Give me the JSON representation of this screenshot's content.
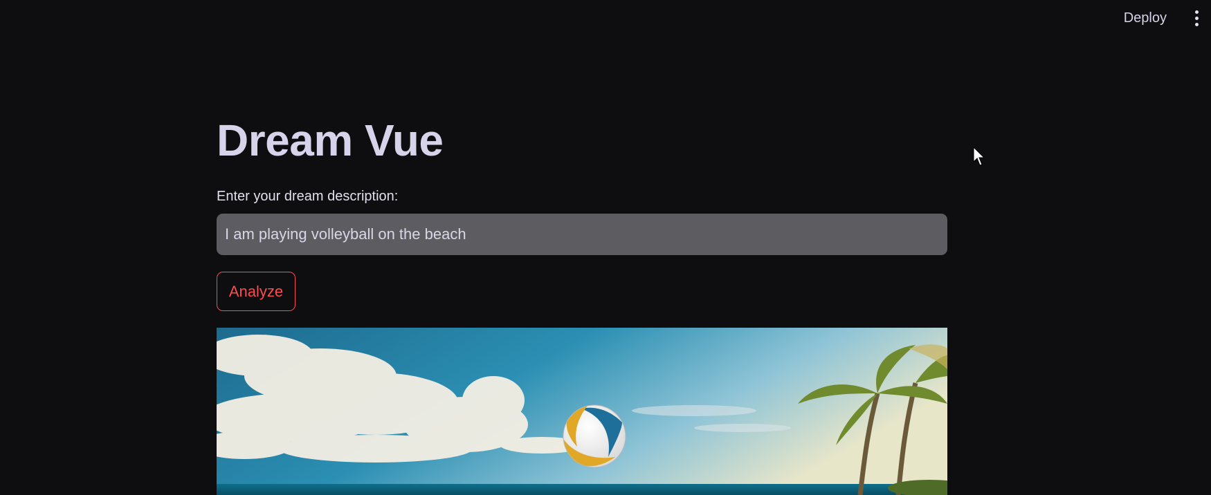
{
  "header": {
    "deploy_label": "Deploy",
    "menu_icon": "kebab-menu-icon"
  },
  "main": {
    "title": "Dream Vue",
    "input_label": "Enter your dream description:",
    "input_value": "I am playing volleyball on the beach",
    "button_label": "Analyze",
    "image_subject": "volleyball-over-beach-image"
  },
  "colors": {
    "background": "#0e0d0f",
    "text": "#d6d3e8",
    "input_bg": "#5d5c61",
    "accent": "#ff4b4b"
  }
}
